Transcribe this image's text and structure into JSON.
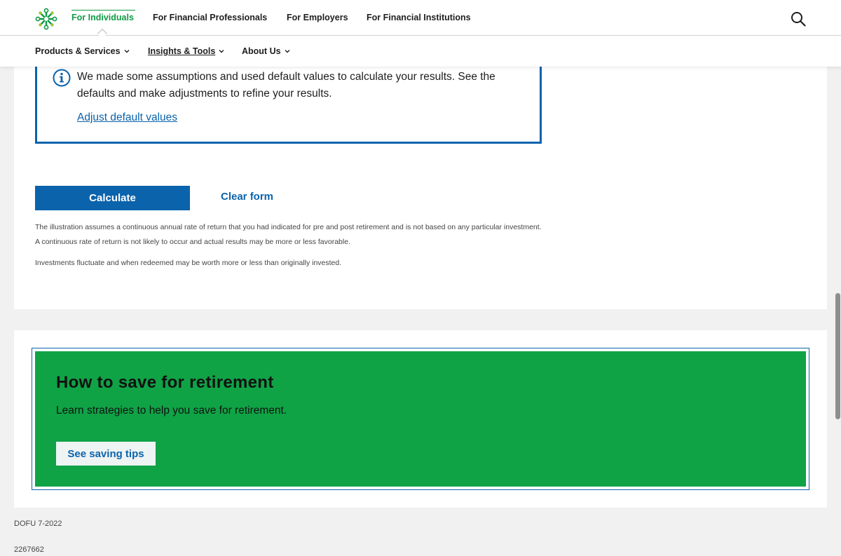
{
  "header": {
    "nav": [
      {
        "label": "For Individuals",
        "active": true
      },
      {
        "label": "For Financial Professionals",
        "active": false
      },
      {
        "label": "For Employers",
        "active": false
      },
      {
        "label": "For Financial Institutions",
        "active": false
      }
    ],
    "accent_color": "#0f9a44",
    "search_icon": "search-icon"
  },
  "subnav": {
    "items": [
      {
        "label": "Products & Services"
      },
      {
        "label": "Insights & Tools",
        "current": true
      },
      {
        "label": "About Us"
      }
    ]
  },
  "notice": {
    "icon": "info-icon",
    "text": "We made some assumptions and used default values to calculate your results. See the defaults and make adjustments to refine your results.",
    "link": "Adjust default values",
    "border_color": "#0b63ac"
  },
  "form": {
    "calculate_label": "Calculate",
    "clear_label": "Clear form"
  },
  "disclaimers": [
    "The illustration assumes a continuous annual rate of return that you had indicated for pre and post retirement and is not based on any particular investment. A continuous rate of return is not likely to occur and actual results may be more or less favorable.",
    "Investments fluctuate and when redeemed may be worth more or less than originally invested."
  ],
  "promo": {
    "title": "How to save for retirement",
    "subtitle": "Learn strategies to help you save for retirement.",
    "button": "See saving tips",
    "background": "#0fa346"
  },
  "footer": {
    "code1": "DOFU 7-2022",
    "code2": "2267662"
  }
}
